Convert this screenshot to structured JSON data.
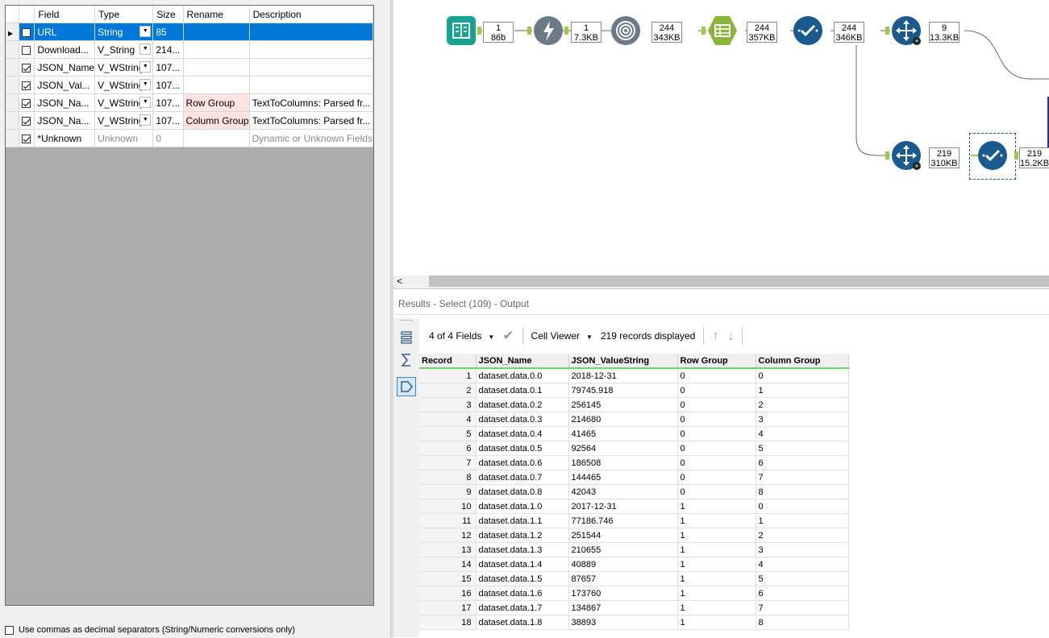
{
  "select_config": {
    "headers": {
      "field": "Field",
      "type": "Type",
      "size": "Size",
      "rename": "Rename",
      "description": "Description"
    },
    "rows": [
      {
        "checked": false,
        "field": "URL",
        "type": "String",
        "size": "85",
        "rename": "",
        "description": ""
      },
      {
        "checked": false,
        "field": "Download...",
        "type": "V_String",
        "size": "214...",
        "rename": "",
        "description": ""
      },
      {
        "checked": true,
        "field": "JSON_Name",
        "type": "V_WString",
        "size": "107...",
        "rename": "",
        "description": ""
      },
      {
        "checked": true,
        "field": "JSON_Val...",
        "type": "V_WString",
        "size": "107...",
        "rename": "",
        "description": ""
      },
      {
        "checked": true,
        "field": "JSON_Na...",
        "type": "V_WString",
        "size": "107...",
        "rename": "Row Group",
        "description": "TextToColumns: Parsed fr..."
      },
      {
        "checked": true,
        "field": "JSON_Na...",
        "type": "V_WString",
        "size": "107...",
        "rename": "Column Group",
        "description": "TextToColumns: Parsed fr..."
      },
      {
        "checked": true,
        "field": "*Unknown",
        "type": "Unknown",
        "size": "0",
        "rename": "",
        "description": "Dynamic or Unknown Fields"
      }
    ],
    "decimal_option_label": "Use commas as decimal separators (String/Numeric conversions only)"
  },
  "workflow": {
    "labels": [
      {
        "count": "1",
        "size": "86b"
      },
      {
        "count": "1",
        "size": "7.3KB"
      },
      {
        "count": "244",
        "size": "343KB"
      },
      {
        "count": "244",
        "size": "357KB"
      },
      {
        "count": "244",
        "size": "346KB"
      },
      {
        "count": "9",
        "size": "13.3KB"
      },
      {
        "count": "219",
        "size": "310KB"
      },
      {
        "count": "219",
        "size": "15.2KB"
      }
    ],
    "colors": {
      "input": "#1aa393",
      "download": "#6b7a87",
      "parse": "#6b7a87",
      "transform": "#8bb53a",
      "select": "#1a5a8e",
      "anchor": "#9dc94b"
    }
  },
  "results": {
    "title": "Results - Select (109) - Output",
    "fields_label": "4 of 4 Fields",
    "cell_viewer_label": "Cell Viewer",
    "records_label": "219 records displayed",
    "columns": [
      "Record",
      "JSON_Name",
      "JSON_ValueString",
      "Row Group",
      "Column Group"
    ],
    "rows": [
      [
        "1",
        "dataset.data.0.0",
        "2018-12-31",
        "0",
        "0"
      ],
      [
        "2",
        "dataset.data.0.1",
        "79745.918",
        "0",
        "1"
      ],
      [
        "3",
        "dataset.data.0.2",
        "256145",
        "0",
        "2"
      ],
      [
        "4",
        "dataset.data.0.3",
        "214680",
        "0",
        "3"
      ],
      [
        "5",
        "dataset.data.0.4",
        "41465",
        "0",
        "4"
      ],
      [
        "6",
        "dataset.data.0.5",
        "92564",
        "0",
        "5"
      ],
      [
        "7",
        "dataset.data.0.6",
        "186508",
        "0",
        "6"
      ],
      [
        "8",
        "dataset.data.0.7",
        "144465",
        "0",
        "7"
      ],
      [
        "9",
        "dataset.data.0.8",
        "42043",
        "0",
        "8"
      ],
      [
        "10",
        "dataset.data.1.0",
        "2017-12-31",
        "1",
        "0"
      ],
      [
        "11",
        "dataset.data.1.1",
        "77186.746",
        "1",
        "1"
      ],
      [
        "12",
        "dataset.data.1.2",
        "251544",
        "1",
        "2"
      ],
      [
        "13",
        "dataset.data.1.3",
        "210655",
        "1",
        "3"
      ],
      [
        "14",
        "dataset.data.1.4",
        "40889",
        "1",
        "4"
      ],
      [
        "15",
        "dataset.data.1.5",
        "87657",
        "1",
        "5"
      ],
      [
        "16",
        "dataset.data.1.6",
        "173760",
        "1",
        "6"
      ],
      [
        "17",
        "dataset.data.1.7",
        "134867",
        "1",
        "7"
      ],
      [
        "18",
        "dataset.data.1.8",
        "38893",
        "1",
        "8"
      ]
    ]
  }
}
